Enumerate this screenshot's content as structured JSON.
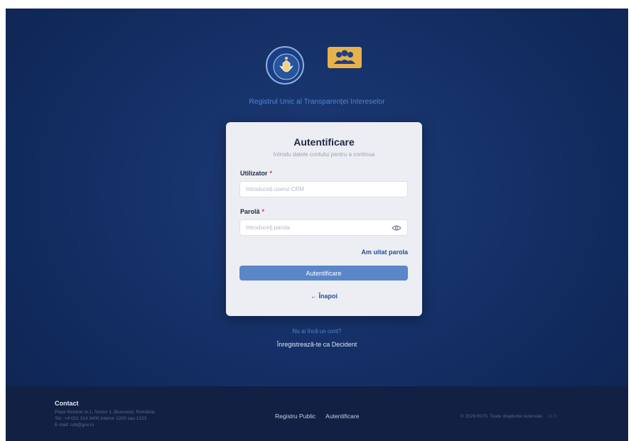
{
  "header": {
    "seal_icon": "government-seal-icon",
    "seal_text_top": "GUVERNUL",
    "seal_text_bottom": "ROMÂNIEI",
    "app_logo_icon": "people-group-icon",
    "app_title": "Registrul Unic al Transparenței Intereselor"
  },
  "login": {
    "title": "Autentificare",
    "subtitle": "Introdu datele contului pentru a continua",
    "username_label": "Utilizator",
    "username_placeholder": "Introduceți userul CRM",
    "username_value": "",
    "password_label": "Parolă",
    "password_placeholder": "Introduceți parola",
    "password_value": "",
    "required_mark": "*",
    "forgot_password": "Am uitat parola",
    "submit_label": "Autentificare",
    "back_label": "← Înapoi"
  },
  "register": {
    "prompt": "Nu ai încă un cont?",
    "link": "Înregistrează-te ca Decident"
  },
  "footer": {
    "contact_title": "Contact",
    "address": "Piața Victoriei nr.1, Sector 1, București, România",
    "phone": "Tel.: +4 021 314 3400 interior 1203 sau 1223",
    "email": "E-mail: ruti@gov.ro",
    "links": [
      "Registru Public",
      "Autentificare"
    ],
    "copyright": "© 2026 RUTI. Toate drepturile rezervate.",
    "copyright_extra": "v1.0"
  },
  "colors": {
    "background": "#15306a",
    "accent": "#5b86c8",
    "link": "#1f4fa0",
    "required": "#d6334a",
    "footer": "#122044"
  }
}
